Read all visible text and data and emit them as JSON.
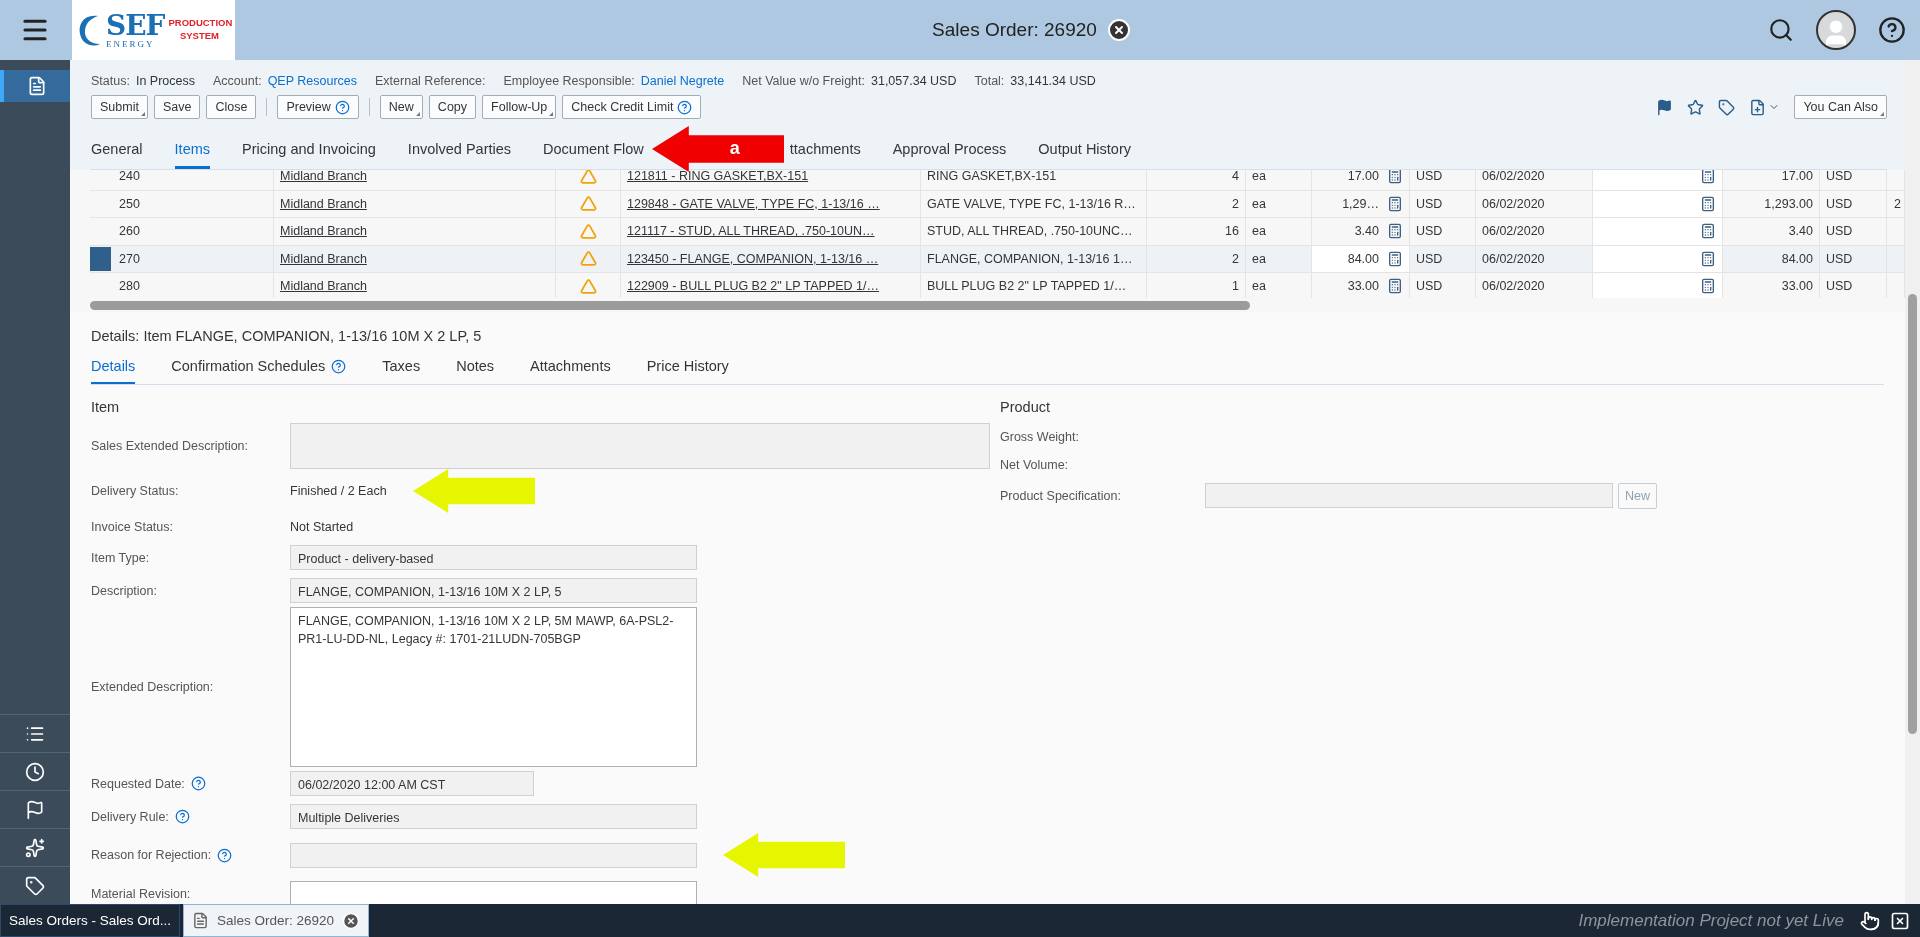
{
  "shell": {
    "title": "Sales Order: 26920",
    "logo": {
      "name": "SEF",
      "sub": "ENERGY",
      "tagline": "PRODUCTION SYSTEM"
    }
  },
  "sidebar": {
    "items": [
      {
        "kind": "document",
        "selected": true
      },
      {
        "kind": "list",
        "selected": false
      },
      {
        "kind": "clock",
        "selected": false
      },
      {
        "kind": "flag",
        "selected": false
      },
      {
        "kind": "favorites",
        "selected": false
      },
      {
        "kind": "tag",
        "selected": false
      }
    ]
  },
  "header": {
    "facts": [
      {
        "label": "Status:",
        "value": "In Process",
        "link": false
      },
      {
        "label": "Account:",
        "value": "QEP Resources",
        "link": true
      },
      {
        "label": "External Reference:"
      },
      {
        "label": "Employee Responsible:",
        "value": "Daniel Negrete",
        "link": true
      },
      {
        "label": "Net Value w/o Freight:",
        "value": "31,057.34 USD",
        "link": false
      },
      {
        "label": "Total:",
        "value": "33,141.34 USD",
        "link": false
      }
    ],
    "toolbar": [
      [
        {
          "label": "Submit",
          "menu": true,
          "help": false
        },
        {
          "label": "Save",
          "menu": false,
          "help": false
        },
        {
          "label": "Close",
          "menu": false,
          "help": false
        }
      ],
      [
        {
          "label": "Preview",
          "menu": false,
          "help": true
        }
      ],
      [
        {
          "label": "New",
          "menu": true,
          "help": false
        },
        {
          "label": "Copy",
          "menu": false,
          "help": false
        },
        {
          "label": "Follow-Up",
          "menu": true,
          "help": false
        },
        {
          "label": "Check Credit Limit",
          "menu": false,
          "help": true
        }
      ]
    ],
    "actions": [
      {
        "kind": "flag"
      },
      {
        "kind": "star"
      },
      {
        "kind": "tag"
      },
      {
        "kind": "new-document"
      }
    ],
    "more_button": {
      "label": "You Can Also",
      "menu": true
    },
    "tabs": [
      {
        "kind": "tab",
        "label": "General",
        "selected": false
      },
      {
        "kind": "tab",
        "label": "Items",
        "selected": true
      },
      {
        "kind": "tab",
        "label": "Pricing and Invoicing",
        "selected": false
      },
      {
        "kind": "tab",
        "label": "Involved Parties",
        "selected": false
      },
      {
        "kind": "tab",
        "label": "Document Flow",
        "selected": false
      },
      {
        "kind": "callout",
        "label": "a"
      },
      {
        "kind": "tab",
        "label": "ttachments",
        "selected": false
      },
      {
        "kind": "tab",
        "label": "Approval Process",
        "selected": false
      },
      {
        "kind": "tab",
        "label": "Output History",
        "selected": false
      }
    ]
  },
  "table": {
    "rows": [
      {
        "item": "240",
        "branch": "Midland Branch",
        "warning": true,
        "product": "121811 - RING GASKET,BX-151",
        "description": "RING GASKET,BX-151",
        "qty": "4",
        "unit": "ea",
        "price": "17.00",
        "currency": "USD",
        "date": "06/02/2020",
        "amount": "17.00",
        "amount_currency": "USD",
        "selected": false
      },
      {
        "item": "250",
        "branch": "Midland Branch",
        "warning": true,
        "product": "129848 - GATE VALVE, TYPE FC, 1-13/16 …",
        "description": "GATE VALVE, TYPE FC, 1-13/16 R…",
        "qty": "2",
        "unit": "ea",
        "price": "1,29…",
        "currency": "USD",
        "date": "06/02/2020",
        "amount": "1,293.00",
        "amount_currency": "USD",
        "column_15": "2",
        "selected": false
      },
      {
        "item": "260",
        "branch": "Midland Branch",
        "warning": true,
        "product": "121117 - STUD, ALL THREAD, .750-10UN…",
        "description": "STUD, ALL THREAD, .750-10UNC…",
        "qty": "16",
        "unit": "ea",
        "price": "3.40",
        "currency": "USD",
        "date": "06/02/2020",
        "amount": "3.40",
        "amount_currency": "USD",
        "selected": false
      },
      {
        "item": "270",
        "branch": "Midland Branch",
        "warning": true,
        "product": "123450 - FLANGE, COMPANION, 1-13/16 …",
        "description": "FLANGE, COMPANION, 1-13/16 1…",
        "qty": "2",
        "unit": "ea",
        "price": "84.00",
        "currency": "USD",
        "date": "06/02/2020",
        "amount": "84.00",
        "amount_currency": "USD",
        "selected": true
      },
      {
        "item": "280",
        "branch": "Midland Branch",
        "warning": true,
        "product": "122909 - BULL PLUG B2 2\" LP TAPPED 1/…",
        "description": "BULL PLUG B2 2\" LP TAPPED 1/…",
        "qty": "1",
        "unit": "ea",
        "price": "33.00",
        "currency": "USD",
        "date": "06/02/2020",
        "amount": "33.00",
        "amount_currency": "USD",
        "selected": false
      }
    ]
  },
  "details": {
    "title": "Details: Item FLANGE, COMPANION, 1-13/16 10M X 2 LP, 5",
    "tabs": [
      {
        "label": "Details",
        "help": false,
        "selected": true
      },
      {
        "label": "Confirmation Schedules",
        "help": true,
        "selected": false
      },
      {
        "label": "Taxes",
        "help": false,
        "selected": false
      },
      {
        "label": "Notes",
        "help": false,
        "selected": false
      },
      {
        "label": "Attachments",
        "help": false,
        "selected": false
      },
      {
        "label": "Price History",
        "help": false,
        "selected": false
      }
    ],
    "item_section": {
      "title": "Item",
      "rows": [
        {
          "label": "Sales Extended Description:",
          "kind": "wide",
          "help": false,
          "editable": false,
          "callout": false
        },
        {
          "label": "Delivery Status:",
          "kind": "text",
          "value": "Finished / 2 Each",
          "help": false,
          "callout": true
        },
        {
          "label": "Invoice Status:",
          "kind": "text",
          "value": "Not Started",
          "help": false,
          "callout": false
        },
        {
          "label": "Item Type:",
          "kind": "field",
          "value": "Product - delivery-based",
          "help": false,
          "editable": false,
          "callout": false
        },
        {
          "label": "Description:",
          "kind": "field",
          "value": "FLANGE, COMPANION, 1-13/16 10M X 2 LP, 5",
          "help": false,
          "editable": false,
          "callout": false
        },
        {
          "label": "Extended Description:",
          "kind": "area",
          "value": "FLANGE, COMPANION, 1-13/16 10M X 2 LP, 5M MAWP, 6A-PSL2-PR1-LU-DD-NL, Legacy #: 1701-21LUDN-705BGP",
          "help": false,
          "editable": true,
          "callout": false
        },
        {
          "label": "Requested Date:",
          "kind": "short",
          "value": "06/02/2020 12:00 AM CST",
          "help": true,
          "editable": false,
          "callout": false
        },
        {
          "label": "Delivery Rule:",
          "kind": "field",
          "value": "Multiple Deliveries",
          "help": true,
          "editable": false,
          "callout": false
        },
        {
          "label": "Reason for Rejection:",
          "kind": "field",
          "help": true,
          "editable": false,
          "callout": true
        },
        {
          "label": "Material Revision:",
          "kind": "field",
          "help": false,
          "editable": true,
          "callout": false
        }
      ]
    },
    "product_section": {
      "title": "Product",
      "rows": [
        {
          "label": "Gross Weight:",
          "kind": "text"
        },
        {
          "label": "Net Volume:",
          "kind": "text"
        },
        {
          "label": "Product Specification:",
          "kind": "field",
          "button": "New"
        }
      ]
    }
  },
  "bottom_bar": {
    "tabs": [
      {
        "label": "Sales Orders - Sales Ord...",
        "selected": false
      },
      {
        "label": "Sales Order: 26920",
        "selected": true
      }
    ],
    "notice": "Implementation Project not yet Live"
  }
}
